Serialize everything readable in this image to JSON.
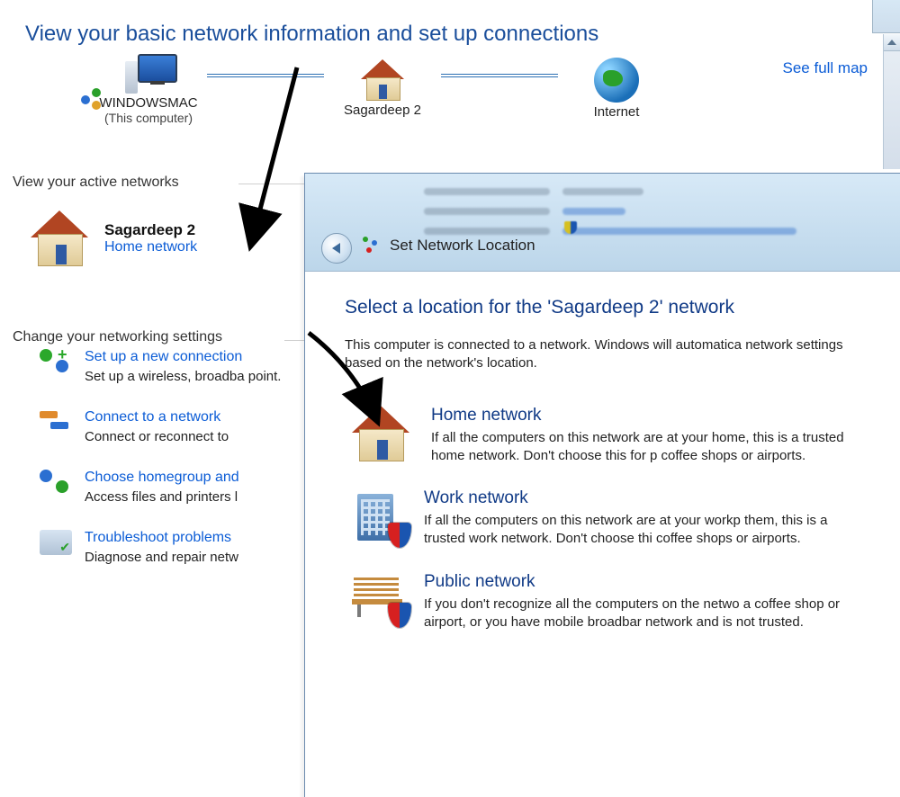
{
  "bg": {
    "title": "View your basic network information and set up connections",
    "see_map": "See full map",
    "map": {
      "this_pc": "WINDOWSMAC",
      "this_pc_sub": "(This computer)",
      "network": "Sagardeep  2",
      "internet": "Internet"
    },
    "active_heading": "View your active networks",
    "active": {
      "name": "Sagardeep  2",
      "type": "Home network"
    },
    "settings_heading": "Change your networking settings",
    "settings": [
      {
        "link": "Set up a new connection",
        "desc": "Set up a wireless, broadba point."
      },
      {
        "link": "Connect to a network",
        "desc": "Connect or reconnect to "
      },
      {
        "link": "Choose homegroup and ",
        "desc": "Access files and printers l"
      },
      {
        "link": "Troubleshoot problems",
        "desc": "Diagnose and repair netw"
      }
    ]
  },
  "dialog": {
    "title": "Set Network Location",
    "heading": "Select a location for the 'Sagardeep  2' network",
    "desc": "This computer is connected to a network. Windows will automatica network settings based on the network's location.",
    "options": [
      {
        "title": "Home network",
        "text": "If all the computers on this network are at your home, this is a trusted home network.  Don't choose this for p coffee shops or airports."
      },
      {
        "title": "Work network",
        "text": "If all the computers on this network are at your workp them, this is a trusted work network.  Don't choose thi coffee shops or airports."
      },
      {
        "title": "Public network",
        "text": "If you don't recognize all the computers on the netwo a coffee shop or airport, or you have mobile broadbar network and is not trusted."
      }
    ]
  }
}
